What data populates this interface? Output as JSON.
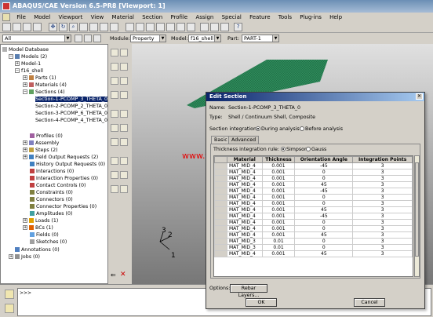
{
  "window": {
    "title": "ABAQUS/CAE Version 6.5-PR8 [Viewport: 1]"
  },
  "menu": [
    "File",
    "Model",
    "Viewport",
    "View",
    "Material",
    "Section",
    "Profile",
    "Assign",
    "Special",
    "Feature",
    "Tools",
    "Plug-ins",
    "Help"
  ],
  "context": {
    "filter_value": "All",
    "module_label": "Module:",
    "module_value": "Property",
    "model_label": "Model:",
    "model_value": "f16_shell",
    "part_label": "Part:",
    "part_value": "PART-1"
  },
  "tree": {
    "root": "Model Database",
    "models": "Models (2)",
    "model1": "Model-1",
    "f16": "f16_shell",
    "parts": "Parts (1)",
    "materials": "Materials (4)",
    "sections": "Sections (4)",
    "section_items": [
      "Section-1-PCOMP_3_THETA_0",
      "Section-2-PCOMP_2_THETA_0",
      "Section-3-PCOMP_6_THETA_0",
      "Section-4-PCOMP_4_THETA_0"
    ],
    "rest": [
      "Profiles (0)",
      "Assembly",
      "Steps (2)",
      "Field Output Requests (2)",
      "History Output Requests (0)",
      "Interactions (0)",
      "Interaction Properties (0)",
      "Contact Controls (0)",
      "Constraints (0)",
      "Connectors (0)",
      "Connector Properties (0)",
      "Amplitudes (0)",
      "Loads (1)",
      "BCs (1)",
      "Fields (0)",
      "Sketches (0)"
    ],
    "annotations": "Annotations (0)",
    "jobs": "Jobs (0)"
  },
  "viewport": {
    "watermark": "www.feaonline.com.cn",
    "triad": [
      "3",
      "2",
      "1"
    ]
  },
  "cmd": {
    "prompt": ">>>"
  },
  "dialog": {
    "title": "Edit Section",
    "name_label": "Name:",
    "name_value": "Section-1-PCOMP_3_THETA_0",
    "type_label": "Type:",
    "type_value": "Shell / Continuum Shell, Composite",
    "integration_label": "Section integration:",
    "during": "During analysis",
    "before": "Before analysis",
    "tabs": [
      "Basic",
      "Advanced"
    ],
    "thick_rule_label": "Thickness integration rule:",
    "simpson": "Simpson",
    "gauss": "Gauss",
    "columns": [
      "Material",
      "Thickness",
      "Orientation Angle",
      "Integration Points"
    ],
    "rows": [
      [
        "MAT_MID_4",
        "0.001",
        "-45",
        "3"
      ],
      [
        "MAT_MID_4",
        "0.001",
        "0",
        "3"
      ],
      [
        "MAT_MID_4",
        "0.001",
        "0",
        "3"
      ],
      [
        "MAT_MID_4",
        "0.001",
        "45",
        "3"
      ],
      [
        "MAT_MID_4",
        "0.001",
        "-45",
        "3"
      ],
      [
        "MAT_MID_4",
        "0.001",
        "0",
        "3"
      ],
      [
        "MAT_MID_4",
        "0.001",
        "0",
        "3"
      ],
      [
        "MAT_MID_4",
        "0.001",
        "45",
        "3"
      ],
      [
        "MAT_MID_4",
        "0.001",
        "-45",
        "3"
      ],
      [
        "MAT_MID_4",
        "0.001",
        "0",
        "3"
      ],
      [
        "MAT_MID_4",
        "0.001",
        "0",
        "3"
      ],
      [
        "MAT_MID_4",
        "0.001",
        "45",
        "3"
      ],
      [
        "MAT_MID_3",
        "0.01",
        "0",
        "3"
      ],
      [
        "MAT_MID_3",
        "0.01",
        "0",
        "3"
      ],
      [
        "MAT_MID_4",
        "0.001",
        "45",
        "3"
      ]
    ],
    "options_label": "Options:",
    "rebar_button": "Rebar Layers...",
    "ok": "OK",
    "cancel": "Cancel"
  }
}
